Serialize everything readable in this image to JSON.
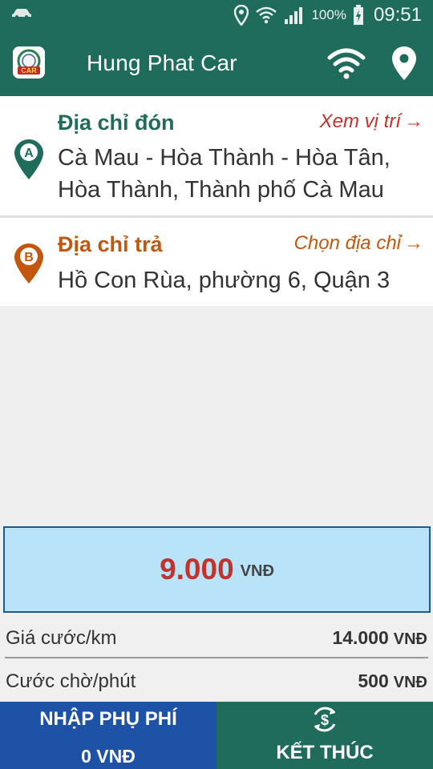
{
  "status_bar": {
    "battery_percent": "100%",
    "time": "09:51",
    "icons": [
      "car-icon",
      "location-icon",
      "wifi-icon",
      "signal-icon",
      "battery-charging-icon"
    ]
  },
  "app_bar": {
    "title": "Hung Phat Car",
    "logo_text": "CAR",
    "icons": [
      "app-logo-icon",
      "wifi-icon",
      "location-pin-icon"
    ]
  },
  "pickup": {
    "label": "Địa chỉ đón",
    "action": "Xem vị trí",
    "marker": "A",
    "address_line1": "Cà Mau - Hòa Thành - Hòa Tân,",
    "address_line2": "Hòa Thành, Thành phố Cà Mau"
  },
  "dropoff": {
    "label": "Địa chỉ trả",
    "action": "Chọn địa chỉ",
    "marker": "B",
    "address": "Hồ Con Rùa, phường 6, Quận 3"
  },
  "fare": {
    "amount": "9.000",
    "unit": "VNĐ"
  },
  "rates": [
    {
      "label": "Giá cước/km",
      "value": "14.000",
      "unit": "VNĐ"
    },
    {
      "label": "Cước chờ/phút",
      "value": "500",
      "unit": "VNĐ"
    }
  ],
  "buttons": {
    "surcharge_label": "NHẬP PHỤ PHÍ",
    "surcharge_value": "0 VNĐ",
    "finish_label": "KẾT THÚC"
  },
  "colors": {
    "primary": "#1f6b5c",
    "pickup_accent": "#1f6b5c",
    "dropoff_accent": "#c2570f",
    "fare_red": "#c3332e",
    "fare_bg": "#b9e3f8",
    "surcharge_blue": "#1e52a7"
  }
}
